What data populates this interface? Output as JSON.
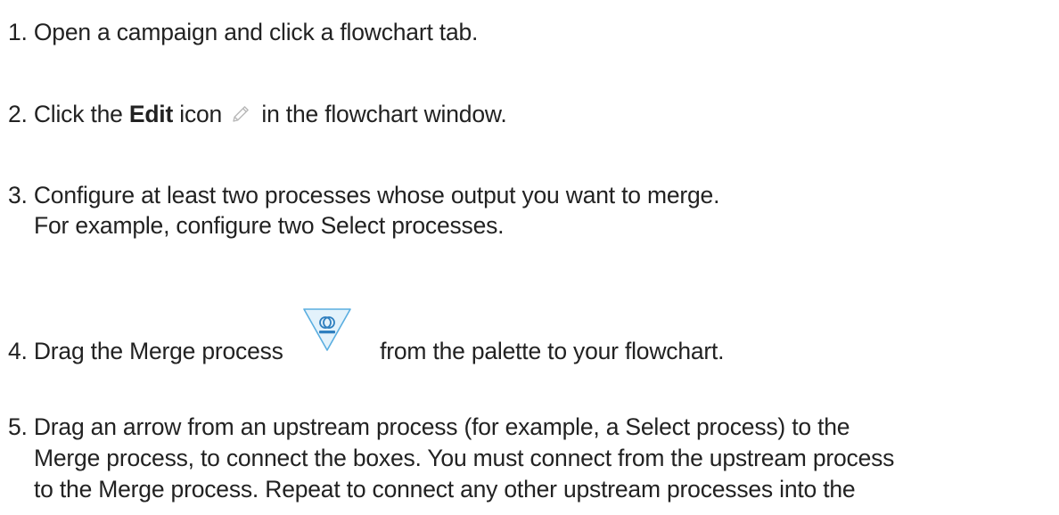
{
  "steps": [
    {
      "lines": [
        "1. Open a campaign and click a flowchart tab."
      ]
    },
    {
      "before": "2. Click the ",
      "bold": "Edit",
      "middle": " icon",
      "after": "in the flowchart window.",
      "icon": "pencil-icon"
    },
    {
      "lines": [
        "3. Configure at least two processes whose output you want to merge.",
        "For example, configure two Select processes."
      ]
    },
    {
      "before": "4. Drag the Merge process",
      "after": "from the palette to your flowchart.",
      "icon": "merge-process-icon"
    },
    {
      "lines": [
        "5. Drag an arrow from an upstream process (for example, a Select process) to the",
        "Merge process, to connect the boxes. You must connect from the upstream process",
        "to the Merge process. Repeat to connect any other upstream processes into the"
      ]
    }
  ],
  "colors": {
    "text": "#222222",
    "pencil_icon": "#b8b8b8",
    "merge_icon_fill": "#e3f2fb",
    "merge_icon_stroke": "#5aaee0",
    "merge_icon_glyph": "#2f7fbf"
  }
}
